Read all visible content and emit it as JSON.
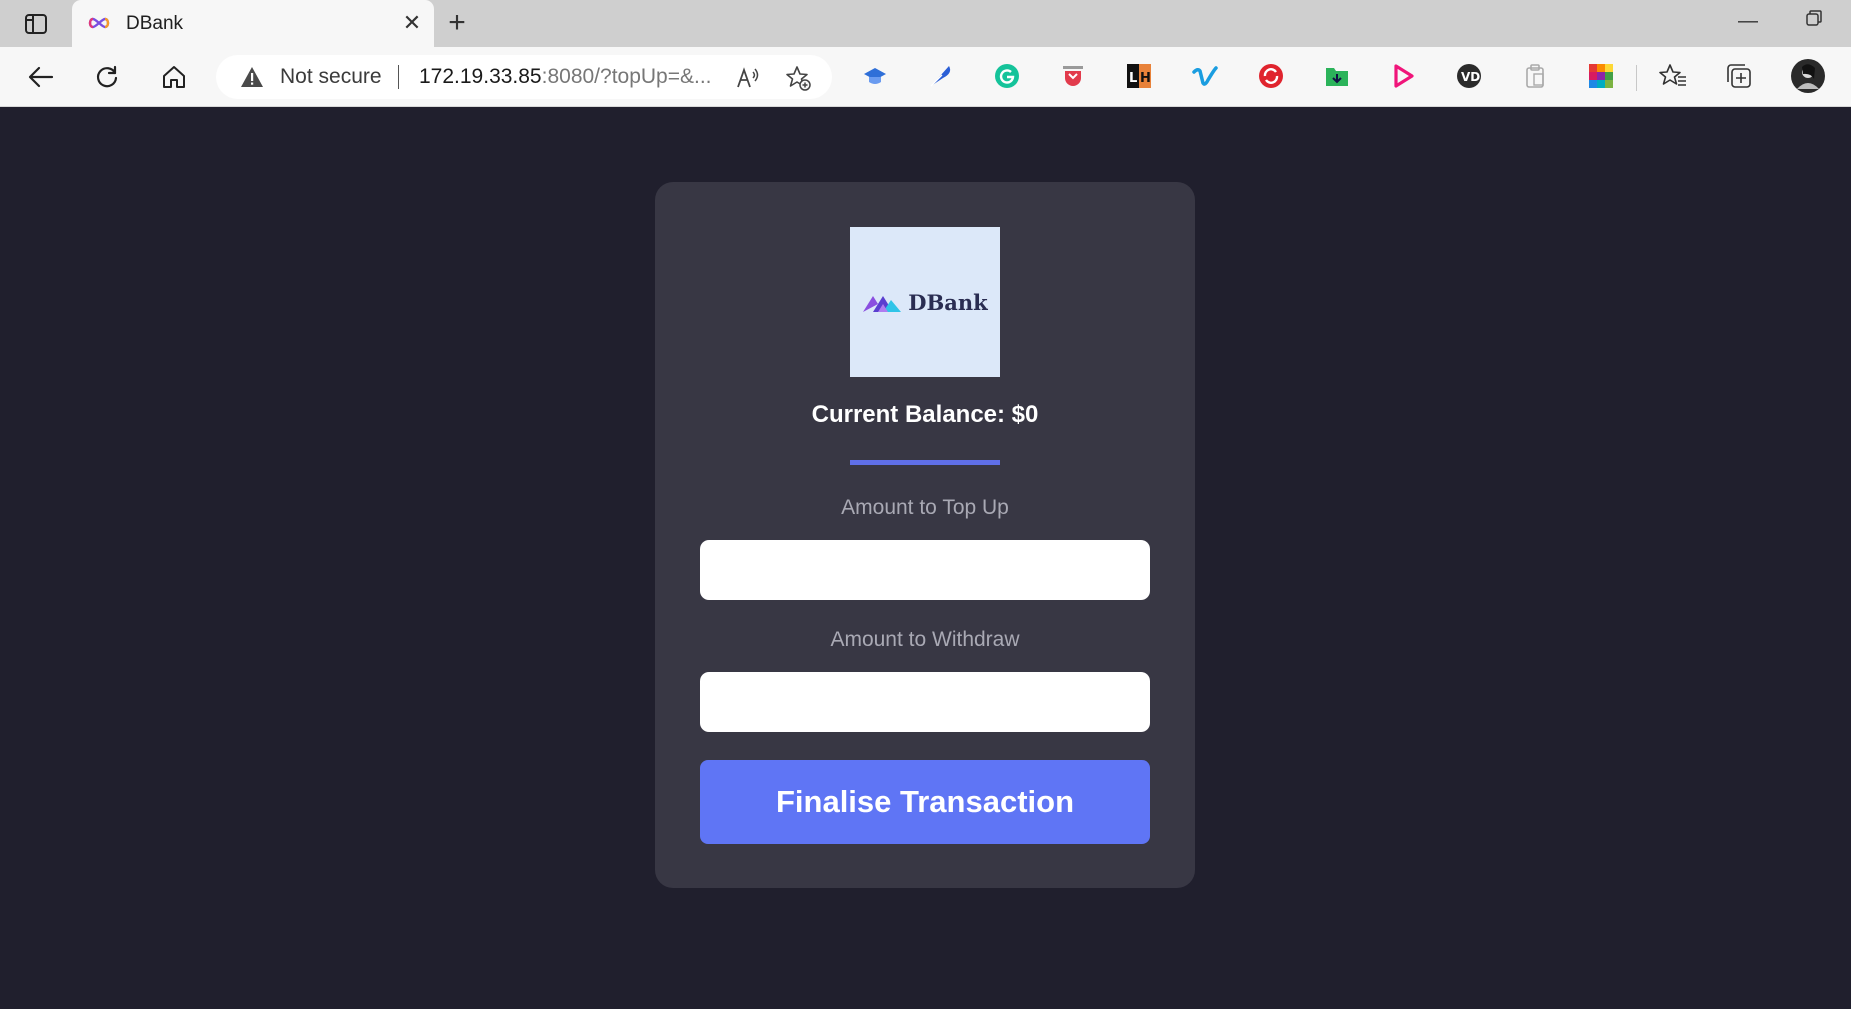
{
  "browser": {
    "tab": {
      "title": "DBank",
      "favicon": "infinity-icon"
    },
    "address": {
      "security_label": "Not secure",
      "url_host": "172.19.33.85",
      "url_rest": ":8080/?topUp=&..."
    },
    "extensions": [
      "graduation-cap-icon",
      "quill-icon",
      "grammarly-icon",
      "pocket-icon",
      "lh-icon",
      "vimeo-icon",
      "lastpass-icon",
      "download-folder-icon",
      "play-icon",
      "vpn-icon",
      "clipboard-icon",
      "color-grid-icon"
    ]
  },
  "app": {
    "logo_text": "DBank",
    "balance_text": "Current Balance: $0",
    "topup": {
      "label": "Amount to Top Up",
      "value": ""
    },
    "withdraw": {
      "label": "Amount to Withdraw",
      "value": ""
    },
    "submit_label": "Finalise Transaction"
  },
  "colors": {
    "page_bg": "#201f2d",
    "card_bg": "#383744",
    "accent": "#5f75f5",
    "logo_bg": "#dce8f9"
  }
}
